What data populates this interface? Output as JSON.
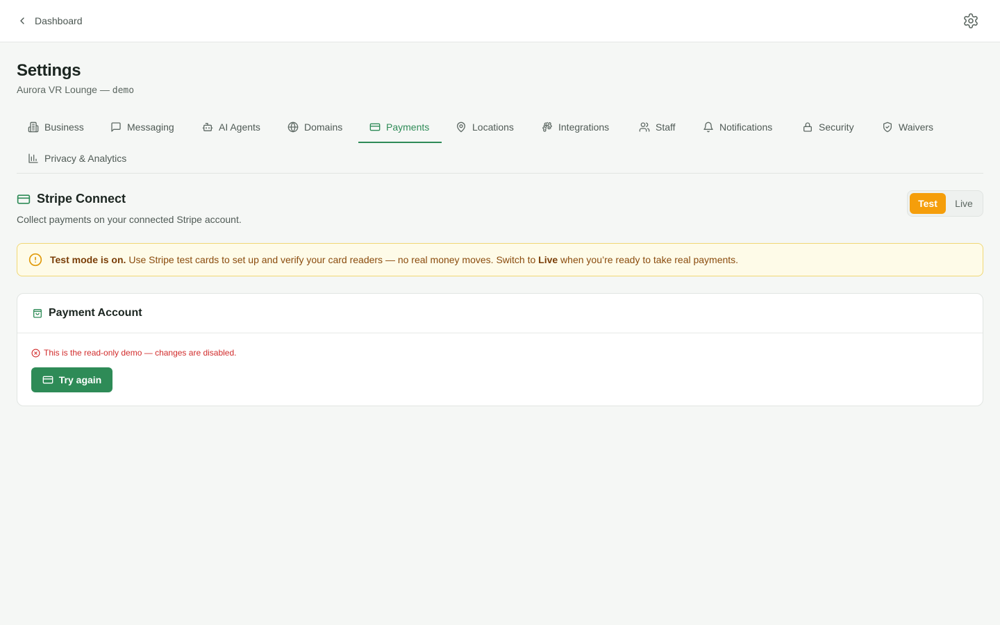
{
  "topbar": {
    "back_label": "Dashboard",
    "back_icon": "chevron-left-icon",
    "settings_icon": "gear-icon"
  },
  "page": {
    "title": "Settings",
    "subtitle_prefix": "Aurora VR Lounge —",
    "subtitle_tag": "demo"
  },
  "tabs": [
    {
      "label": "Business",
      "icon": "building-icon"
    },
    {
      "label": "Messaging",
      "icon": "message-icon"
    },
    {
      "label": "AI Agents",
      "icon": "bot-icon"
    },
    {
      "label": "Domains",
      "icon": "globe-icon"
    },
    {
      "label": "Payments",
      "icon": "credit-card-icon",
      "active": true
    },
    {
      "label": "Locations",
      "icon": "map-pin-icon"
    },
    {
      "label": "Integrations",
      "icon": "puzzle-icon"
    },
    {
      "label": "Staff",
      "icon": "users-icon"
    },
    {
      "label": "Notifications",
      "icon": "bell-icon"
    },
    {
      "label": "Security",
      "icon": "lock-icon"
    },
    {
      "label": "Waivers",
      "icon": "shield-check-icon"
    },
    {
      "label": "Privacy & Analytics",
      "icon": "bar-chart-icon"
    }
  ],
  "stripe": {
    "title": "Stripe Connect",
    "description": "Collect payments on your connected Stripe account.",
    "mode_test": "Test",
    "mode_live": "Live",
    "selected_mode": "Test"
  },
  "alert": {
    "bold_lead": "Test mode is on.",
    "text_before_live": " Use Stripe test cards to set up and verify your card readers — no real money moves. Switch to ",
    "live_word": "Live",
    "text_after_live": " when you’re ready to take real payments."
  },
  "payment_account": {
    "title": "Payment Account",
    "error": "This is the read-only demo — changes are disabled.",
    "retry_label": "Try again"
  },
  "colors": {
    "accent": "#2e8b57",
    "test_mode": "#f59e0b",
    "alert_bg": "#fefbe8",
    "error": "#d12b2b"
  }
}
